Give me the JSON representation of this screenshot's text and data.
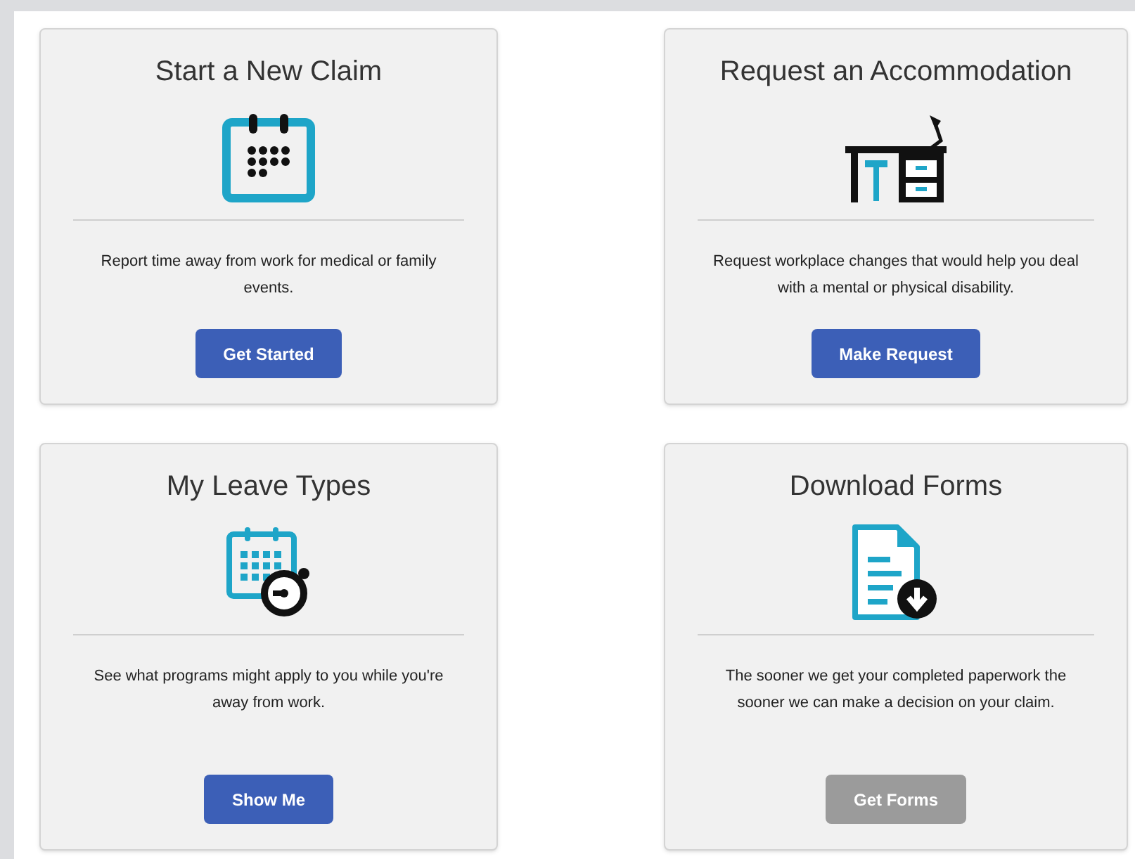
{
  "cards": [
    {
      "title": "Start a New Claim",
      "kind": "calendar",
      "description": "Report time away from work for medical or family events.",
      "button": {
        "label": "Get Started",
        "disabled": false
      }
    },
    {
      "title": "Request an Accommodation",
      "kind": "desk",
      "description": "Request workplace changes that would help you deal with a mental or physical disability.",
      "button": {
        "label": "Make Request",
        "disabled": false
      }
    },
    {
      "title": "My Leave Types",
      "kind": "calendar-clock",
      "description": "See what programs might apply to you while you're away from work.",
      "button": {
        "label": "Show Me",
        "disabled": false
      }
    },
    {
      "title": "Download Forms",
      "kind": "document-download",
      "description": "The sooner we get your completed paperwork the sooner we can make a decision on your claim.",
      "button": {
        "label": "Get Forms",
        "disabled": true
      }
    }
  ]
}
